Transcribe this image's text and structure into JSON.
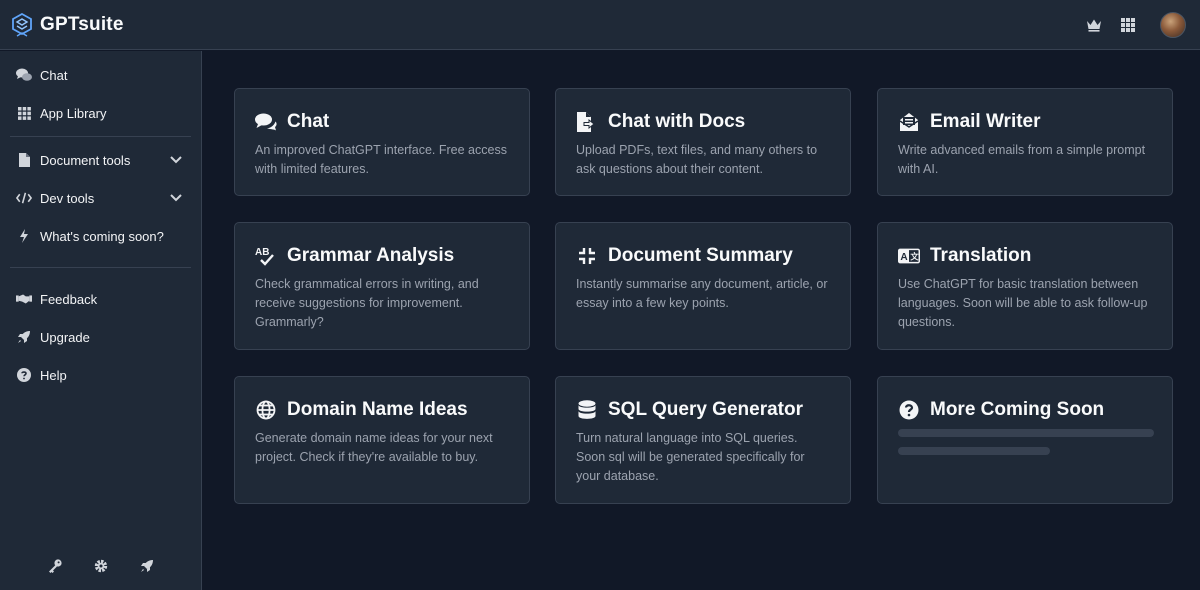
{
  "app": {
    "name": "GPTsuite"
  },
  "sidebar": {
    "items": [
      {
        "label": "Chat",
        "icon": "comments-icon"
      },
      {
        "label": "App Library",
        "icon": "grid-icon"
      },
      {
        "label": "Document tools",
        "icon": "document-icon",
        "expandable": true
      },
      {
        "label": "Dev tools",
        "icon": "code-icon",
        "expandable": true
      },
      {
        "label": "What's coming soon?",
        "icon": "bolt-icon"
      },
      {
        "label": "Feedback",
        "icon": "handshake-icon"
      },
      {
        "label": "Upgrade",
        "icon": "rocket-icon"
      },
      {
        "label": "Help",
        "icon": "question-icon"
      }
    ],
    "bottom_icons": [
      "key-icon",
      "gear-icon",
      "rocket-icon"
    ]
  },
  "cards": [
    {
      "title": "Chat",
      "icon": "comments-icon",
      "description": "An improved ChatGPT interface. Free access with limited features."
    },
    {
      "title": "Chat with Docs",
      "icon": "file-import-icon",
      "description": "Upload PDFs, text files, and many others to ask questions about their content."
    },
    {
      "title": "Email Writer",
      "icon": "envelope-open-icon",
      "description": "Write advanced emails from a simple prompt with AI."
    },
    {
      "title": "Grammar Analysis",
      "icon": "spellcheck-icon",
      "description": "Check grammatical errors in writing, and receive suggestions for improvement. Grammarly?"
    },
    {
      "title": "Document Summary",
      "icon": "compress-icon",
      "description": "Instantly summarise any document, article, or essay into a few key points."
    },
    {
      "title": "Translation",
      "icon": "translate-icon",
      "description": "Use ChatGPT for basic translation between languages. Soon will be able to ask follow-up questions."
    },
    {
      "title": "Domain Name Ideas",
      "icon": "globe-icon",
      "description": "Generate domain name ideas for your next project. Check if they're available to buy."
    },
    {
      "title": "SQL Query Generator",
      "icon": "database-icon",
      "description": "Turn natural language into SQL queries. Soon sql will be generated specifically for your database."
    },
    {
      "title": "More Coming Soon",
      "icon": "question-circle-icon",
      "description": ""
    }
  ],
  "colors": {
    "background": "#111827",
    "panel": "#1f2937",
    "border": "#374151",
    "text_primary": "#f9fafb",
    "text_secondary": "#9ca3af",
    "icon": "#d1d5db",
    "logo_accent": "#60a5fa"
  }
}
